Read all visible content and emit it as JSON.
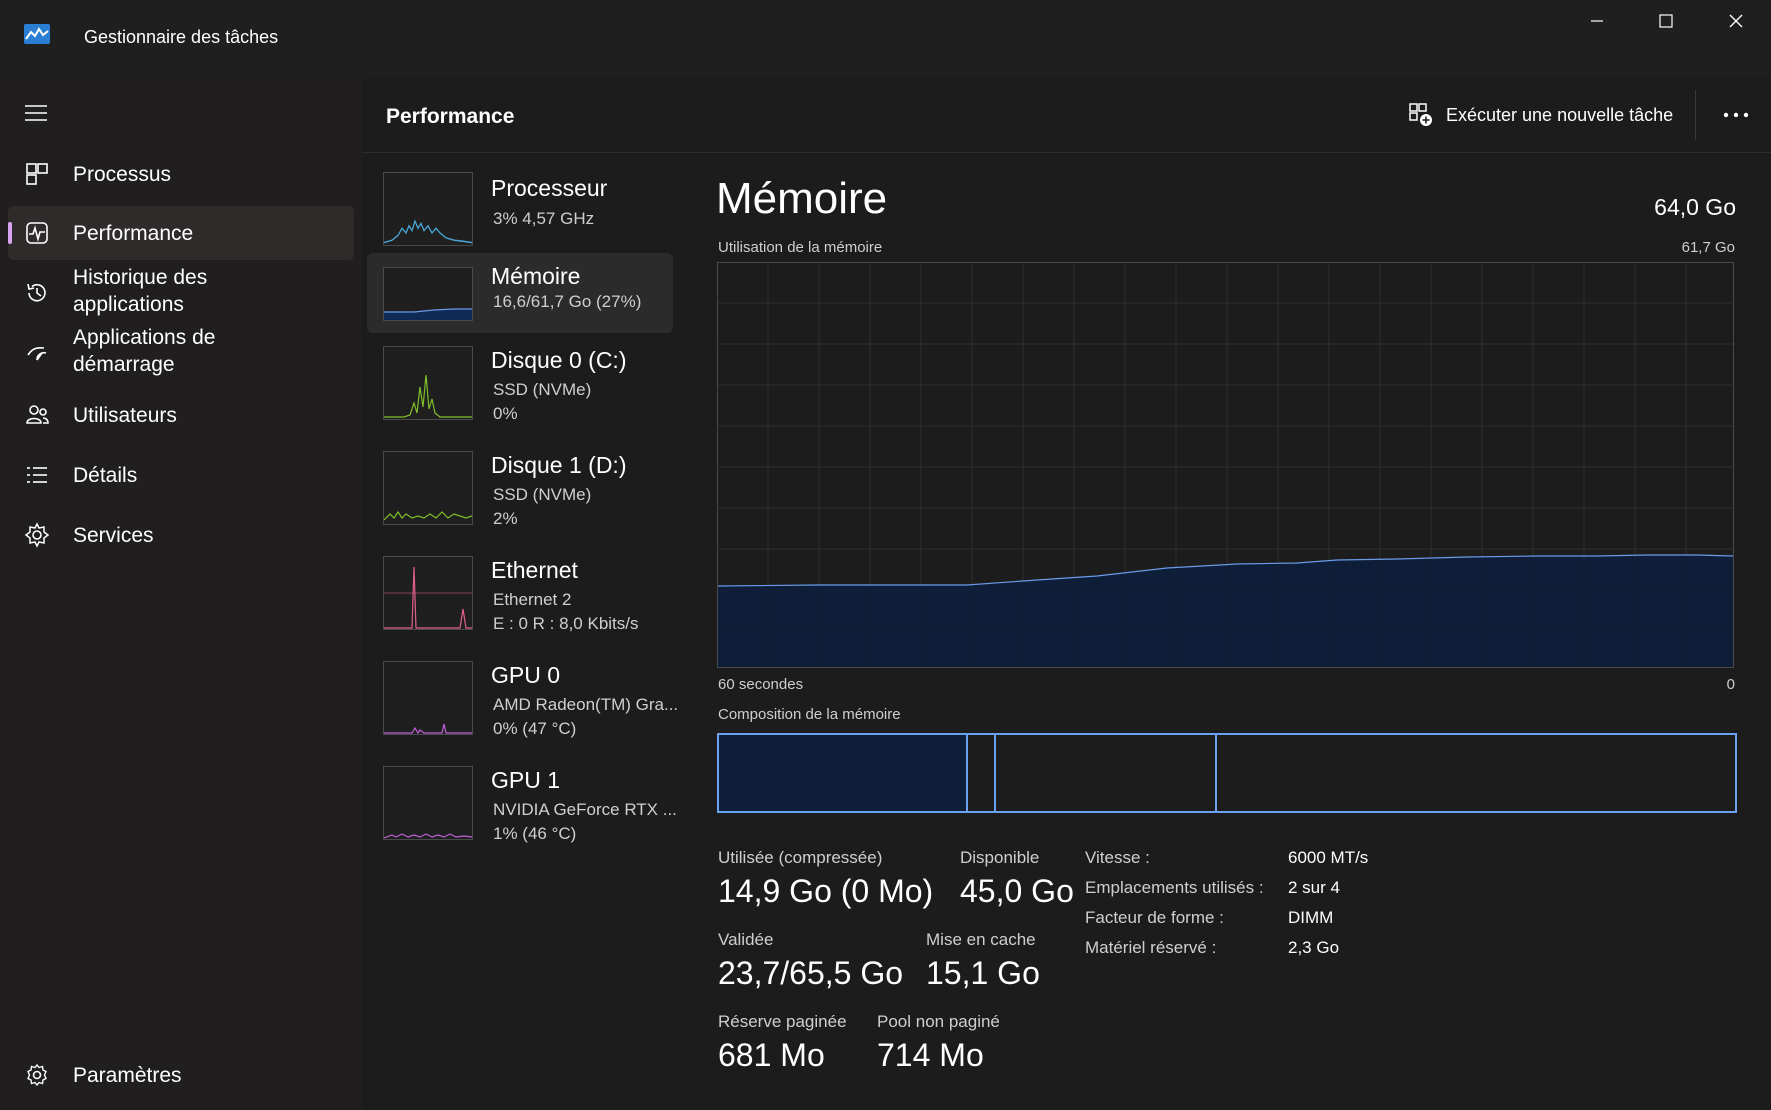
{
  "window": {
    "title": "Gestionnaire des tâches"
  },
  "sidebar": {
    "items": [
      {
        "label": "Processus",
        "icon": "processes-icon"
      },
      {
        "label": "Performance",
        "icon": "performance-icon",
        "active": true
      },
      {
        "label": "Historique des applications",
        "icon": "history-icon"
      },
      {
        "label": "Applications de démarrage",
        "icon": "startup-icon"
      },
      {
        "label": "Utilisateurs",
        "icon": "users-icon"
      },
      {
        "label": "Détails",
        "icon": "details-icon"
      },
      {
        "label": "Services",
        "icon": "services-icon"
      }
    ],
    "settings_label": "Paramètres"
  },
  "header": {
    "title": "Performance",
    "run_task_label": "Exécuter une nouvelle tâche"
  },
  "resources": [
    {
      "title": "Processeur",
      "sub1": "3%  4,57 GHz",
      "sub2": "",
      "color": "#4aa8d8"
    },
    {
      "title": "Mémoire",
      "sub1": "16,6/61,7 Go (27%)",
      "sub2": "",
      "color": "#6a9ae8",
      "active": true
    },
    {
      "title": "Disque 0 (C:)",
      "sub1": "SSD (NVMe)",
      "sub2": "0%",
      "color": "#7fbf2a"
    },
    {
      "title": "Disque 1 (D:)",
      "sub1": "SSD (NVMe)",
      "sub2": "2%",
      "color": "#7fbf2a"
    },
    {
      "title": "Ethernet",
      "sub1": "Ethernet 2",
      "sub2": "E : 0  R : 8,0 Kbits/s",
      "color": "#e0608a"
    },
    {
      "title": "GPU 0",
      "sub1": "AMD Radeon(TM) Gra...",
      "sub2": "0%  (47 °C)",
      "color": "#c060d8"
    },
    {
      "title": "GPU 1",
      "sub1": "NVIDIA GeForce RTX ...",
      "sub2": "1%  (46 °C)",
      "color": "#c060d8"
    }
  ],
  "memory": {
    "title": "Mémoire",
    "total": "64,0 Go",
    "usage_label": "Utilisation de la mémoire",
    "usage_max": "61,7 Go",
    "time_label": "60 secondes",
    "time_end": "0",
    "composition_label": "Composition de la mémoire",
    "stats": {
      "used_label": "Utilisée (compressée)",
      "used_value": "14,9 Go (0 Mo)",
      "available_label": "Disponible",
      "available_value": "45,0 Go",
      "committed_label": "Validée",
      "committed_value": "23,7/65,5 Go",
      "cached_label": "Mise en cache",
      "cached_value": "15,1 Go",
      "paged_label": "Réserve paginée",
      "paged_value": "681 Mo",
      "nonpaged_label": "Pool non paginé",
      "nonpaged_value": "714 Mo"
    },
    "details": [
      {
        "key": "Vitesse :",
        "value": "6000 MT/s"
      },
      {
        "key": "Emplacements utilisés :",
        "value": "2 sur 4"
      },
      {
        "key": "Facteur de forme :",
        "value": "DIMM"
      },
      {
        "key": "Matériel réservé :",
        "value": "2,3 Go"
      }
    ]
  },
  "colors": {
    "accent": "#d6a4f0",
    "memory_line": "#6a9ae8",
    "memory_fill": "#0f1f3a"
  }
}
